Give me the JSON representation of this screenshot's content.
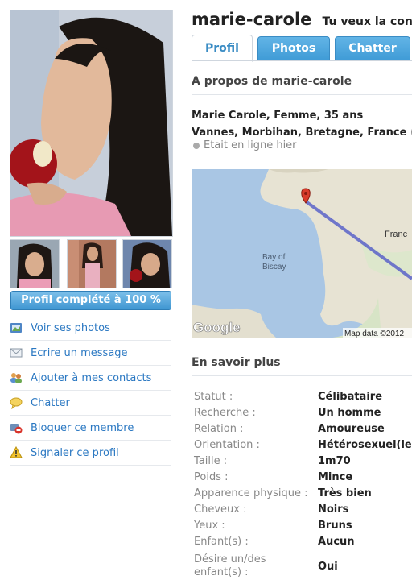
{
  "profile": {
    "username": "marie-carole",
    "tagline": "Tu veux la cont",
    "complete_label": "Profil complété à 100 %"
  },
  "tabs": [
    {
      "label": "Profil"
    },
    {
      "label": "Photos"
    },
    {
      "label": "Chatter"
    }
  ],
  "actions": [
    {
      "label": "Voir ses photos",
      "icon": "image-icon"
    },
    {
      "label": "Ecrire un message",
      "icon": "envelope-icon"
    },
    {
      "label": "Ajouter à mes contacts",
      "icon": "add-contact-icon"
    },
    {
      "label": "Chatter",
      "icon": "chat-bubble-icon"
    },
    {
      "label": "Bloquer ce membre",
      "icon": "block-icon"
    },
    {
      "label": "Signaler ce profil",
      "icon": "warning-icon"
    }
  ],
  "about": {
    "heading": "A propos de marie-carole",
    "identity": "Marie Carole, Femme, 35 ans",
    "location": "Vannes, Morbihan, Bretagne, France",
    "location_suffix": "(",
    "online_status": "Etait en ligne hier"
  },
  "map": {
    "bay_label_1": "Bay of",
    "bay_label_2": "Biscay",
    "country_label": "Franc",
    "brand": "Google",
    "attribution": "Map data ©2012"
  },
  "more": {
    "heading": "En savoir plus",
    "rows": [
      {
        "label": "Statut :",
        "value": "Célibataire"
      },
      {
        "label": "Recherche :",
        "value": "Un homme"
      },
      {
        "label": "Relation :",
        "value": "Amoureuse"
      },
      {
        "label": "Orientation :",
        "value": "Hétérosexuel(le"
      },
      {
        "label": "Taille :",
        "value": "1m70"
      },
      {
        "label": "Poids :",
        "value": "Mince"
      },
      {
        "label": "Apparence physique :",
        "value": "Très bien"
      },
      {
        "label": "Cheveux :",
        "value": "Noirs"
      },
      {
        "label": "Yeux :",
        "value": "Bruns"
      },
      {
        "label": "Enfant(s) :",
        "value": "Aucun"
      },
      {
        "label": "Désire un/des enfant(s) :",
        "value": "Oui"
      }
    ]
  },
  "colors": {
    "link": "#2b78c2",
    "tab": "#4aa3dc",
    "map_water": "#a9c6e4",
    "map_land": "#e7e3d3"
  }
}
